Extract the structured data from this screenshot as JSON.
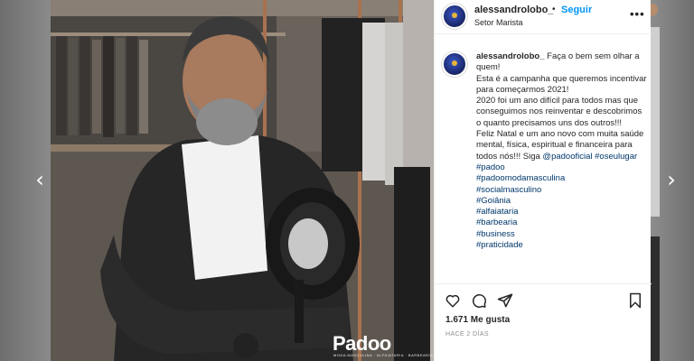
{
  "nav": {
    "prev_glyph": "‹",
    "next_glyph": "›"
  },
  "post": {
    "username": "alessandrolobo_",
    "separator": "•",
    "follow_label": "Seguir",
    "location": "Setor Marista",
    "more_glyph": "•••",
    "brand_logo_text": "Padoo",
    "brand_logo_sub": "MODA MASCULINA · ALFAIATARIA · BARBEARIA",
    "caption": {
      "username": "alessandrolobo_",
      "lines": [
        "Faça o bem sem olhar a quem!",
        "Esta é a campanha que queremos incentivar para começarmos 2021!",
        "2020 foi um ano difícil para todos mas que conseguimos nos reinventar e descobrimos o quanto precisamos uns dos outros!!!",
        "Feliz Natal e um ano novo com muita saúde mental, física, espiritual e financeira para todos nós!!! Siga"
      ],
      "mentions": [
        "@padooficial",
        "#oseulugar"
      ],
      "hashtags": [
        "#padoo",
        "#padoomodamasculina",
        "#socialmasculino",
        "#Goiânia",
        "#alfaiataria",
        "#barbearia",
        "#business",
        "#praticidade"
      ]
    },
    "likes_text": "1.671 Me gusta",
    "time_text": "HACE 2 DÍAS"
  },
  "icons": [
    "heart-icon",
    "comment-icon",
    "share-icon",
    "bookmark-icon"
  ],
  "colors": {
    "link": "#0095f6",
    "hashtag": "#00376b",
    "muted": "#8e8e8e",
    "text": "#262626"
  }
}
